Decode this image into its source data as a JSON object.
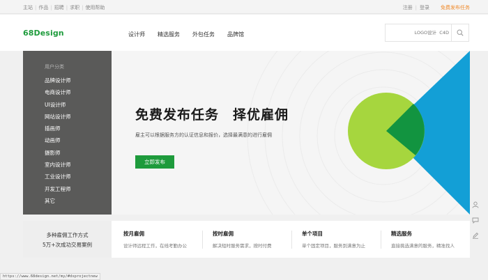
{
  "topbar": {
    "links": [
      "主站",
      "作品",
      "招聘",
      "求职",
      "使用帮助"
    ],
    "register": "注册",
    "login": "登录",
    "publish": "免费发布任务"
  },
  "header": {
    "logo": "68Design",
    "nav": [
      "设计师",
      "精选服务",
      "外包任务",
      "品牌馆"
    ],
    "search_placeholder": "LOGO设计  C4D"
  },
  "sidebar": {
    "title": "用户分类",
    "items": [
      "品牌设计师",
      "电商设计师",
      "UI设计师",
      "网站设计师",
      "插画师",
      "动画师",
      "摄影师",
      "室内设计师",
      "工业设计师",
      "开发工程师",
      "其它"
    ]
  },
  "banner": {
    "title": "免费发布任务　择优雇佣",
    "subtitle": "雇主可以根据服务方的认证信息和报价，选择最满意的进行雇佣",
    "button": "立即发布"
  },
  "features": {
    "lead_line1": "多种雇佣工作方式",
    "lead_line2": "5万+次成功交易案例",
    "items": [
      {
        "title": "按月雇佣",
        "desc": "设计师远程工作，在线考勤办公"
      },
      {
        "title": "按时雇佣",
        "desc": "解决短时服务需求，按时付费"
      },
      {
        "title": "单个项目",
        "desc": "单个固定项目，服务到满意为止"
      },
      {
        "title": "精选服务",
        "desc": "直接挑选满意的服务，精准找人"
      }
    ]
  },
  "statusbar": {
    "url": "https://www.68design.net/my/#dsprojectnew"
  },
  "colors": {
    "brand_green": "#1e9b3c",
    "accent_orange": "#f08a2a",
    "lime": "#a6d63e",
    "blue": "#139fd6"
  }
}
